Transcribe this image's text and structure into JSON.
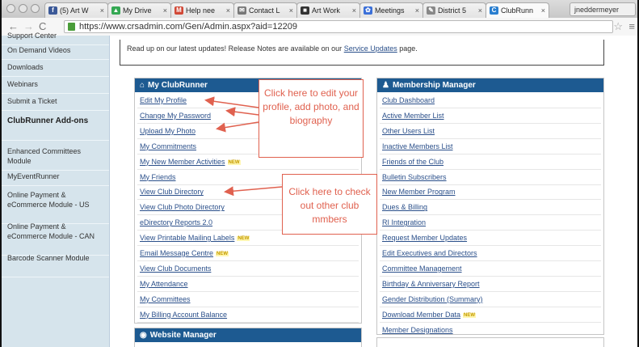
{
  "browser": {
    "tabs": [
      {
        "label": "(5) Art W",
        "icon": "facebook-icon",
        "color": "#3b5998",
        "glyph": "f"
      },
      {
        "label": "My Drive",
        "icon": "drive-icon",
        "color": "#34a853",
        "glyph": "▲"
      },
      {
        "label": "Help nee",
        "icon": "gmail-icon",
        "color": "#d14836",
        "glyph": "M"
      },
      {
        "label": "Contact L",
        "icon": "contact-icon",
        "color": "#777777",
        "glyph": "✉"
      },
      {
        "label": "Art Work",
        "icon": "art-work-icon",
        "color": "#333333",
        "glyph": "■"
      },
      {
        "label": "Meetings",
        "icon": "meetings-icon",
        "color": "#3a6fd8",
        "glyph": "✿"
      },
      {
        "label": "District 5",
        "icon": "district-icon",
        "color": "#888888",
        "glyph": "✎"
      },
      {
        "label": "ClubRunn",
        "icon": "clubrunner-icon",
        "color": "#2a7fd0",
        "glyph": "C"
      }
    ],
    "user": "jneddermeyer",
    "url": "https://www.crsadmin.com/Gen/Admin.aspx?aid=12209"
  },
  "sidebar": {
    "items": [
      {
        "label": "Support Center",
        "kind": "link"
      },
      {
        "label": "On Demand Videos",
        "kind": "link"
      },
      {
        "label": "Downloads",
        "kind": "link"
      },
      {
        "label": "Webinars",
        "kind": "link"
      },
      {
        "label": "Submit a Ticket",
        "kind": "link"
      },
      {
        "label": "ClubRunner Add-ons",
        "kind": "heading"
      },
      {
        "label": "Enhanced Committees Module",
        "kind": "link"
      },
      {
        "label": "MyEventRunner",
        "kind": "link"
      },
      {
        "label": "Online Payment & eCommerce Module - US",
        "kind": "link"
      },
      {
        "label": "Online Payment & eCommerce Module - CAN",
        "kind": "link"
      },
      {
        "label": "Barcode Scanner Module",
        "kind": "link"
      }
    ]
  },
  "notice": {
    "text": "Read up on our latest updates! Release Notes are available on our",
    "link": "Service Updates",
    "suffix": "page."
  },
  "my_clubrunner": {
    "title": "My ClubRunner",
    "icon": "home-icon",
    "links": [
      {
        "label": "Edit My Profile",
        "new": false
      },
      {
        "label": "Change My Password",
        "new": false
      },
      {
        "label": "Upload My Photo",
        "new": false
      },
      {
        "label": "My Commitments",
        "new": false
      },
      {
        "label": "My New Member Activities",
        "new": true
      },
      {
        "label": "My Friends",
        "new": false
      },
      {
        "label": "View Club Directory",
        "new": false
      },
      {
        "label": "View Club Photo Directory",
        "new": false
      },
      {
        "label": "eDirectory Reports 2.0",
        "new": false
      },
      {
        "label": "View Printable Mailing Labels",
        "new": true
      },
      {
        "label": "Email Message Centre",
        "new": true
      },
      {
        "label": "View Club Documents",
        "new": false
      },
      {
        "label": "My Attendance",
        "new": false
      },
      {
        "label": "My Committees",
        "new": false
      },
      {
        "label": "My Billing Account Balance",
        "new": false
      }
    ]
  },
  "membership_manager": {
    "title": "Membership Manager",
    "icon": "users-icon",
    "links": [
      {
        "label": "Club Dashboard",
        "new": false
      },
      {
        "label": "Active Member List",
        "new": false
      },
      {
        "label": "Other Users List",
        "new": false
      },
      {
        "label": "Inactive Members List",
        "new": false
      },
      {
        "label": "Friends of the Club",
        "new": false
      },
      {
        "label": "Bulletin Subscribers",
        "new": false
      },
      {
        "label": "New Member Program",
        "new": false
      },
      {
        "label": "Dues & Billing",
        "new": false
      },
      {
        "label": "RI Integration",
        "new": false
      },
      {
        "label": "Request Member Updates",
        "new": false
      },
      {
        "label": "Edit Executives and Directors",
        "new": false
      },
      {
        "label": "Committee Management",
        "new": false
      },
      {
        "label": "Birthday & Anniversary Report",
        "new": false
      },
      {
        "label": "Gender Distribution (Summary)",
        "new": false
      },
      {
        "label": "Download Member Data",
        "new": true
      },
      {
        "label": "Member Designations",
        "new": false
      }
    ]
  },
  "website_manager": {
    "title": "Website Manager",
    "icon": "globe-icon"
  },
  "new_badge": "NEW",
  "callouts": {
    "profile": "Click here to edit your profile, add photo, and biography",
    "directory": "Click here to check out other club mmbers"
  },
  "colors": {
    "panel_header": "#1d5a91",
    "callout": "#e0614f",
    "sidebar": "#d6e4ec",
    "link": "#2a4f8a"
  }
}
